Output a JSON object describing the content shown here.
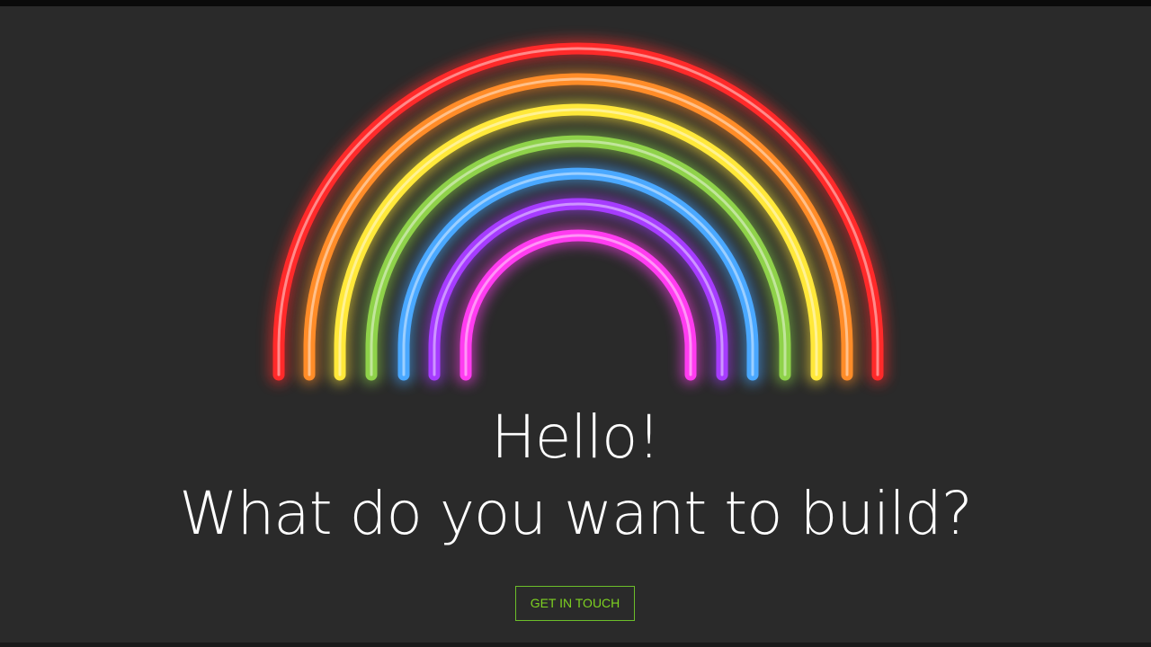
{
  "hero": {
    "greeting": "Hello!",
    "question": "What do you want to build?",
    "cta_label": "GET IN TOUCH"
  },
  "rainbow": {
    "icon": "neon-rainbow-icon",
    "bands": [
      {
        "name": "red",
        "color": "#ff2a2a"
      },
      {
        "name": "orange",
        "color": "#ff8c28"
      },
      {
        "name": "yellow",
        "color": "#ffe83a"
      },
      {
        "name": "green",
        "color": "#8fd24a"
      },
      {
        "name": "blue",
        "color": "#4aa8ff"
      },
      {
        "name": "purple",
        "color": "#a63cff"
      },
      {
        "name": "magenta",
        "color": "#ff3cf0"
      }
    ]
  },
  "colors": {
    "background": "#2a2a2a",
    "accent": "#7ed321",
    "text": "#ffffff"
  }
}
